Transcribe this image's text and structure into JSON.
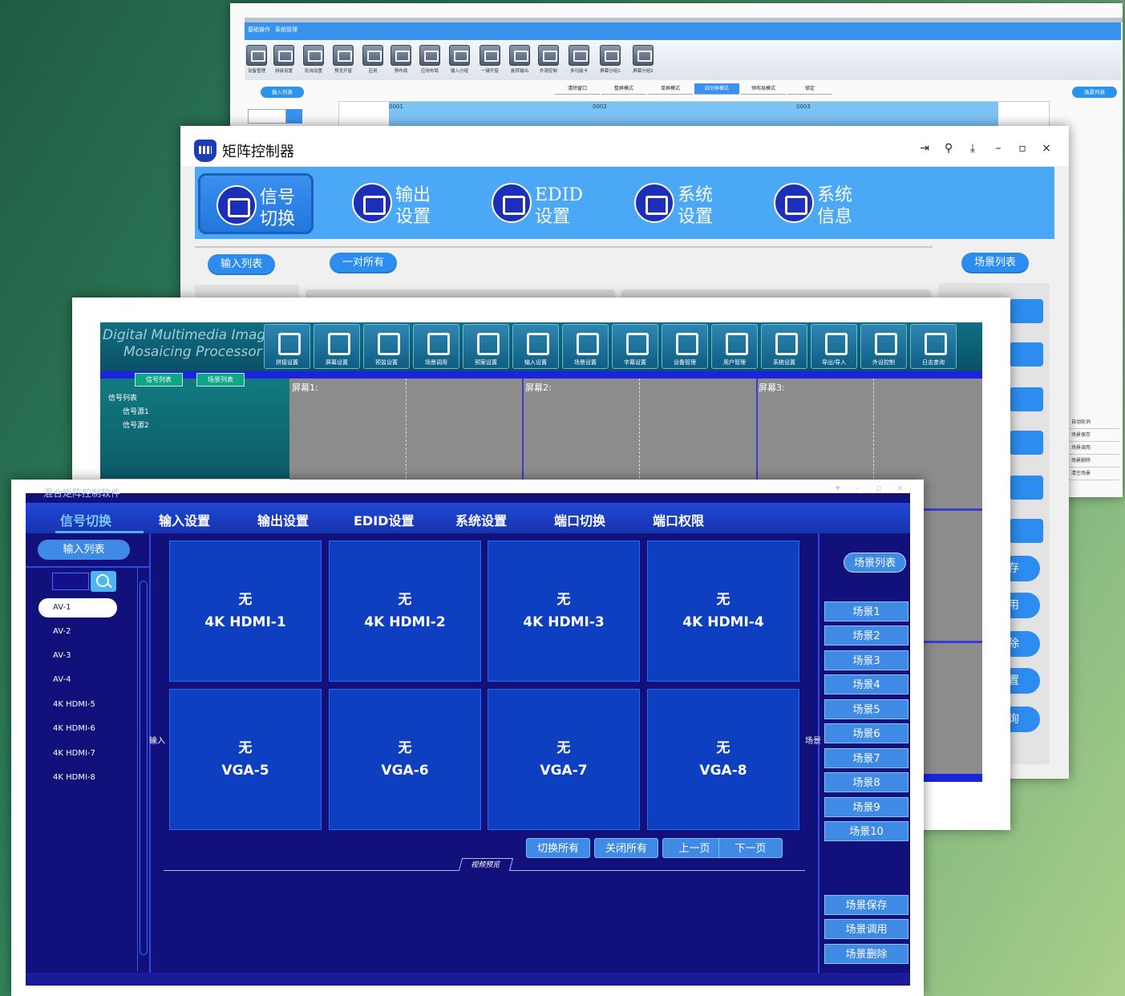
{
  "win1": {
    "menu": [
      "基础操作",
      "系统管理"
    ],
    "tools": [
      "设备管理",
      "拼接设置",
      "轮询设置",
      "预览开窗",
      "应用",
      "预布局",
      "应用布局",
      "输入分组",
      "一键开窗",
      "旋转输出",
      "外观控制",
      "多功能卡",
      "屏幕分组1",
      "屏幕分组2"
    ],
    "input_list": "输入列表",
    "mode_tabs": [
      "清除窗口",
      "整屏模式",
      "单屏模式",
      "四分屏模式",
      "预布局模式",
      "锁定"
    ],
    "screen_nums": [
      "0001",
      "0002",
      "0003"
    ],
    "scene_list": "场景列表",
    "right_menu": [
      "自动轮询",
      "场景保存",
      "场景调用",
      "场景删除",
      "清空场景"
    ]
  },
  "win2": {
    "title": "矩阵控制器",
    "ribbon": [
      {
        "l1": "信号",
        "l2": "切换"
      },
      {
        "l1": "输出",
        "l2": "设置"
      },
      {
        "l1": "EDID",
        "l2": "设置"
      },
      {
        "l1": "系统",
        "l2": "设置"
      },
      {
        "l1": "系统",
        "l2": "信息"
      }
    ],
    "input_list": "输入列表",
    "one_to_all": "一对所有",
    "scene_list": "场景列表",
    "right_frag": [
      "存",
      "用",
      "除",
      "置",
      "询"
    ]
  },
  "win3": {
    "brand_l1": "Digital Multimedia Image",
    "brand_l2": "Mosaicing Processor",
    "tools": [
      "拼接设置",
      "屏幕设置",
      "预监设置",
      "场景调用",
      "预案设置",
      "输入设置",
      "场景设置",
      "字幕设置",
      "设备管理",
      "用户管理",
      "系统设置",
      "导出/导入",
      "外设控制",
      "日志查询"
    ],
    "btn_a": "信号列表",
    "btn_b": "场景列表",
    "tree": [
      "信号列表",
      "信号源1",
      "信号源2"
    ],
    "screens": [
      "屏幕1:",
      "屏幕2:",
      "屏幕3:"
    ]
  },
  "win4": {
    "title": "混合矩阵控制软件",
    "nav": [
      "信号切换",
      "输入设置",
      "输出设置",
      "EDID设置",
      "系统设置",
      "端口切换",
      "端口权限"
    ],
    "input_list": "输入列表",
    "inputs": [
      "AV-1",
      "AV-2",
      "AV-3",
      "AV-4",
      "4K HDMI-5",
      "4K HDMI-6",
      "4K HDMI-7",
      "4K HDMI-8"
    ],
    "side_in": "输入",
    "side_scene": "场景",
    "outputs": [
      {
        "status": "无",
        "name": "4K HDMI-1"
      },
      {
        "status": "无",
        "name": "4K HDMI-2"
      },
      {
        "status": "无",
        "name": "4K HDMI-3"
      },
      {
        "status": "无",
        "name": "4K HDMI-4"
      },
      {
        "status": "无",
        "name": "VGA-5"
      },
      {
        "status": "无",
        "name": "VGA-6"
      },
      {
        "status": "无",
        "name": "VGA-7"
      },
      {
        "status": "无",
        "name": "VGA-8"
      }
    ],
    "actions": [
      "切换所有",
      "关闭所有",
      "上一页",
      "下一页"
    ],
    "preview": "视频预览",
    "scene_list": "场景列表",
    "scenes": [
      "场景1",
      "场景2",
      "场景3",
      "场景4",
      "场景5",
      "场景6",
      "场景7",
      "场景8",
      "场景9",
      "场景10"
    ],
    "scene_ops": [
      "场景保存",
      "场景调用",
      "场景删除"
    ]
  },
  "colors": {
    "front_bg": "#12107b",
    "cell": "#0d3fc0",
    "accent": "#3f8ae4",
    "ribbon": "#4aa8f6",
    "header3": "#0f6f83"
  }
}
